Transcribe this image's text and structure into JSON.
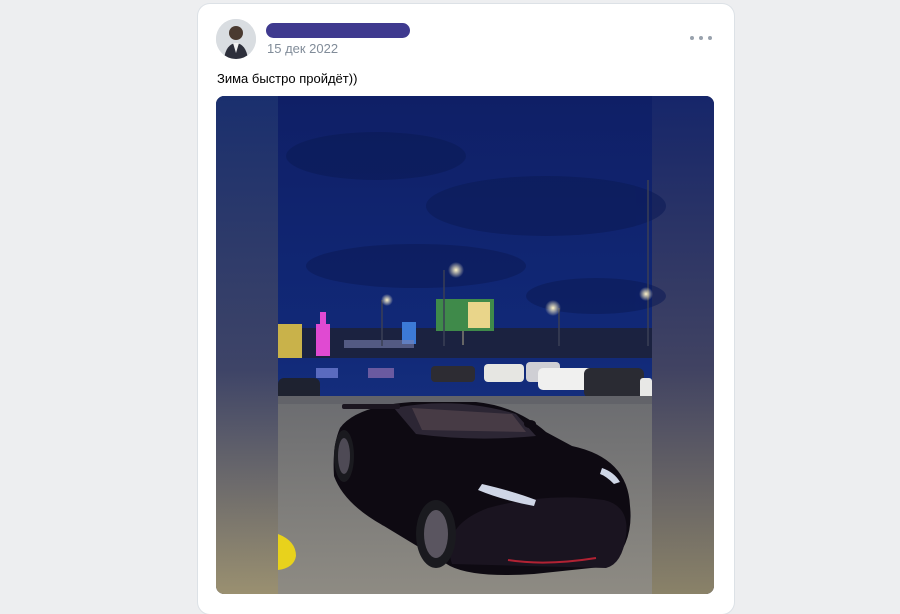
{
  "post": {
    "author_name": "",
    "date": "15 дек 2022",
    "text": "Зима быстро пройдёт))",
    "photo": {
      "billboard_text": ""
    }
  },
  "icons": {
    "more": "more-horizontal-icon"
  },
  "colors": {
    "page_bg": "#edeef0",
    "card_bg": "#ffffff",
    "meta_text": "#818c99",
    "redaction": "#3f3a8f"
  }
}
